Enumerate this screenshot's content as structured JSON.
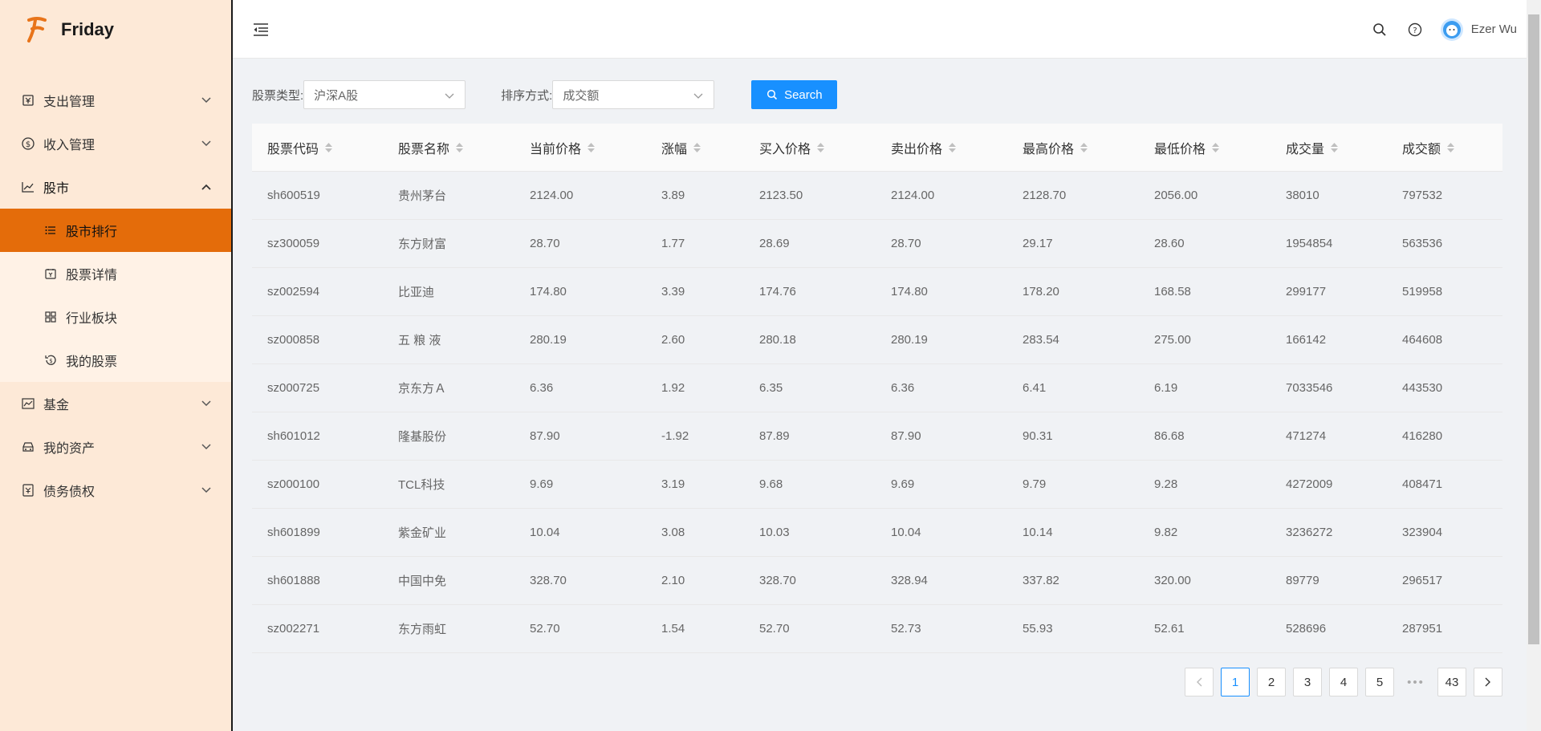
{
  "app": {
    "name": "Friday"
  },
  "sidebar": {
    "items": [
      {
        "label": "支出管理",
        "icon": "wallet-icon"
      },
      {
        "label": "收入管理",
        "icon": "dollar-icon"
      },
      {
        "label": "股市",
        "icon": "chart-line-icon",
        "open": true,
        "children": [
          {
            "label": "股市排行",
            "icon": "list-icon",
            "active": true
          },
          {
            "label": "股票详情",
            "icon": "calendar-icon"
          },
          {
            "label": "行业板块",
            "icon": "grid-icon"
          },
          {
            "label": "我的股票",
            "icon": "history-icon"
          }
        ]
      },
      {
        "label": "基金",
        "icon": "area-chart-icon"
      },
      {
        "label": "我的资产",
        "icon": "car-icon"
      },
      {
        "label": "债务债权",
        "icon": "document-icon"
      }
    ]
  },
  "header": {
    "user": "Ezer Wu"
  },
  "filters": {
    "type_label": "股票类型:",
    "type_value": "沪深A股",
    "sort_label": "排序方式:",
    "sort_value": "成交额",
    "search_label": "Search"
  },
  "table": {
    "columns": [
      "股票代码",
      "股票名称",
      "当前价格",
      "涨幅",
      "买入价格",
      "卖出价格",
      "最高价格",
      "最低价格",
      "成交量",
      "成交额"
    ],
    "rows": [
      [
        "sh600519",
        "贵州茅台",
        "2124.00",
        "3.89",
        "2123.50",
        "2124.00",
        "2128.70",
        "2056.00",
        "38010",
        "797532"
      ],
      [
        "sz300059",
        "东方财富",
        "28.70",
        "1.77",
        "28.69",
        "28.70",
        "29.17",
        "28.60",
        "1954854",
        "563536"
      ],
      [
        "sz002594",
        "比亚迪",
        "174.80",
        "3.39",
        "174.76",
        "174.80",
        "178.20",
        "168.58",
        "299177",
        "519958"
      ],
      [
        "sz000858",
        "五 粮 液",
        "280.19",
        "2.60",
        "280.18",
        "280.19",
        "283.54",
        "275.00",
        "166142",
        "464608"
      ],
      [
        "sz000725",
        "京东方Ａ",
        "6.36",
        "1.92",
        "6.35",
        "6.36",
        "6.41",
        "6.19",
        "7033546",
        "443530"
      ],
      [
        "sh601012",
        "隆基股份",
        "87.90",
        "-1.92",
        "87.89",
        "87.90",
        "90.31",
        "86.68",
        "471274",
        "416280"
      ],
      [
        "sz000100",
        "TCL科技",
        "9.69",
        "3.19",
        "9.68",
        "9.69",
        "9.79",
        "9.28",
        "4272009",
        "408471"
      ],
      [
        "sh601899",
        "紫金矿业",
        "10.04",
        "3.08",
        "10.03",
        "10.04",
        "10.14",
        "9.82",
        "3236272",
        "323904"
      ],
      [
        "sh601888",
        "中国中免",
        "328.70",
        "2.10",
        "328.70",
        "328.94",
        "337.82",
        "320.00",
        "89779",
        "296517"
      ],
      [
        "sz002271",
        "东方雨虹",
        "52.70",
        "1.54",
        "52.70",
        "52.73",
        "55.93",
        "52.61",
        "528696",
        "287951"
      ]
    ]
  },
  "pagination": {
    "pages": [
      "1",
      "2",
      "3",
      "4",
      "5"
    ],
    "ellipsis": "•••",
    "last": "43",
    "current": "1"
  },
  "colors": {
    "accent": "#1890ff",
    "sidebar_bg": "#fde9d7",
    "active_menu": "#e46c0a"
  }
}
